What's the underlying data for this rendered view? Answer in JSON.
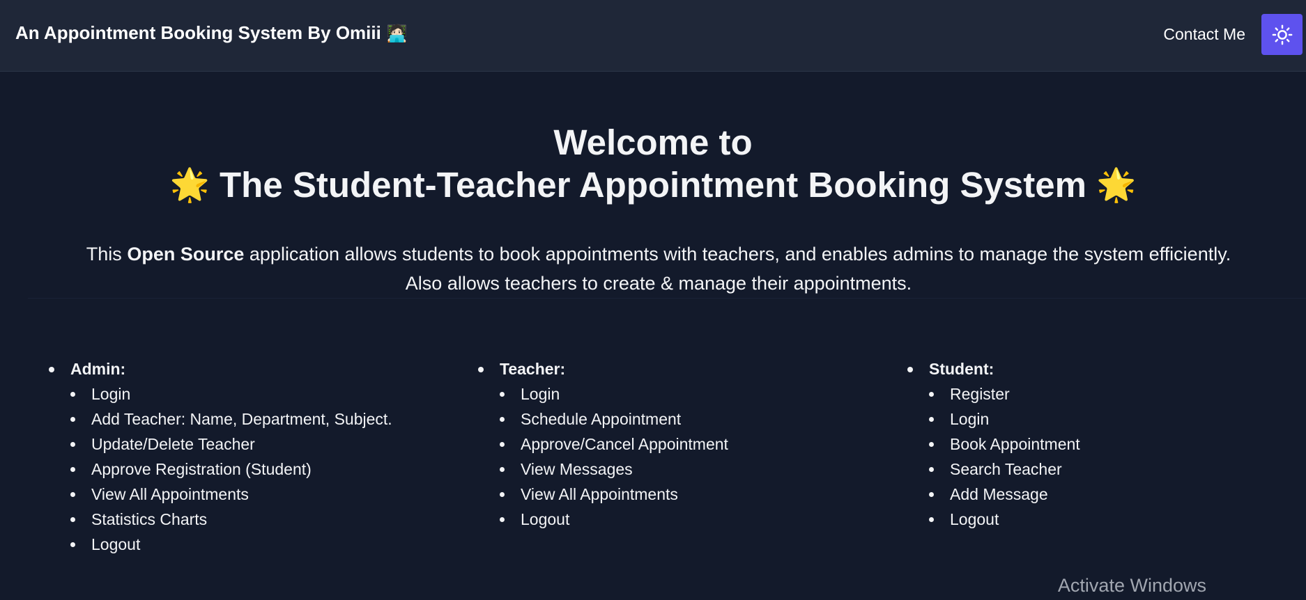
{
  "navbar": {
    "brand": "An Appointment Booking System By Omiii",
    "brand_emoji": "🧑🏻‍💻",
    "contact": "Contact Me",
    "theme_icon": "sun-icon",
    "accent": "#5e52ee"
  },
  "hero": {
    "line1": "Welcome to",
    "line2": "The Student-Teacher Appointment Booking System",
    "star": "🌟",
    "desc_prefix": "This",
    "desc_bold": "Open Source",
    "desc_rest": "application allows students to book appointments with teachers, and enables admins to manage the system efficiently.",
    "desc_line2": "Also allows teachers to create & manage their appointments."
  },
  "roles": {
    "admin": {
      "title": "Admin:",
      "items": [
        "Login",
        "Add Teacher: Name, Department, Subject.",
        "Update/Delete Teacher",
        "Approve Registration (Student)",
        "View All Appointments",
        "Statistics Charts",
        "Logout"
      ]
    },
    "teacher": {
      "title": "Teacher:",
      "items": [
        "Login",
        "Schedule Appointment",
        "Approve/Cancel Appointment",
        "View Messages",
        "View All Appointments",
        "Logout"
      ]
    },
    "student": {
      "title": "Student:",
      "items": [
        "Register",
        "Login",
        "Book Appointment",
        "Search Teacher",
        "Add Message",
        "Logout"
      ]
    }
  },
  "watermark": "Activate Windows"
}
